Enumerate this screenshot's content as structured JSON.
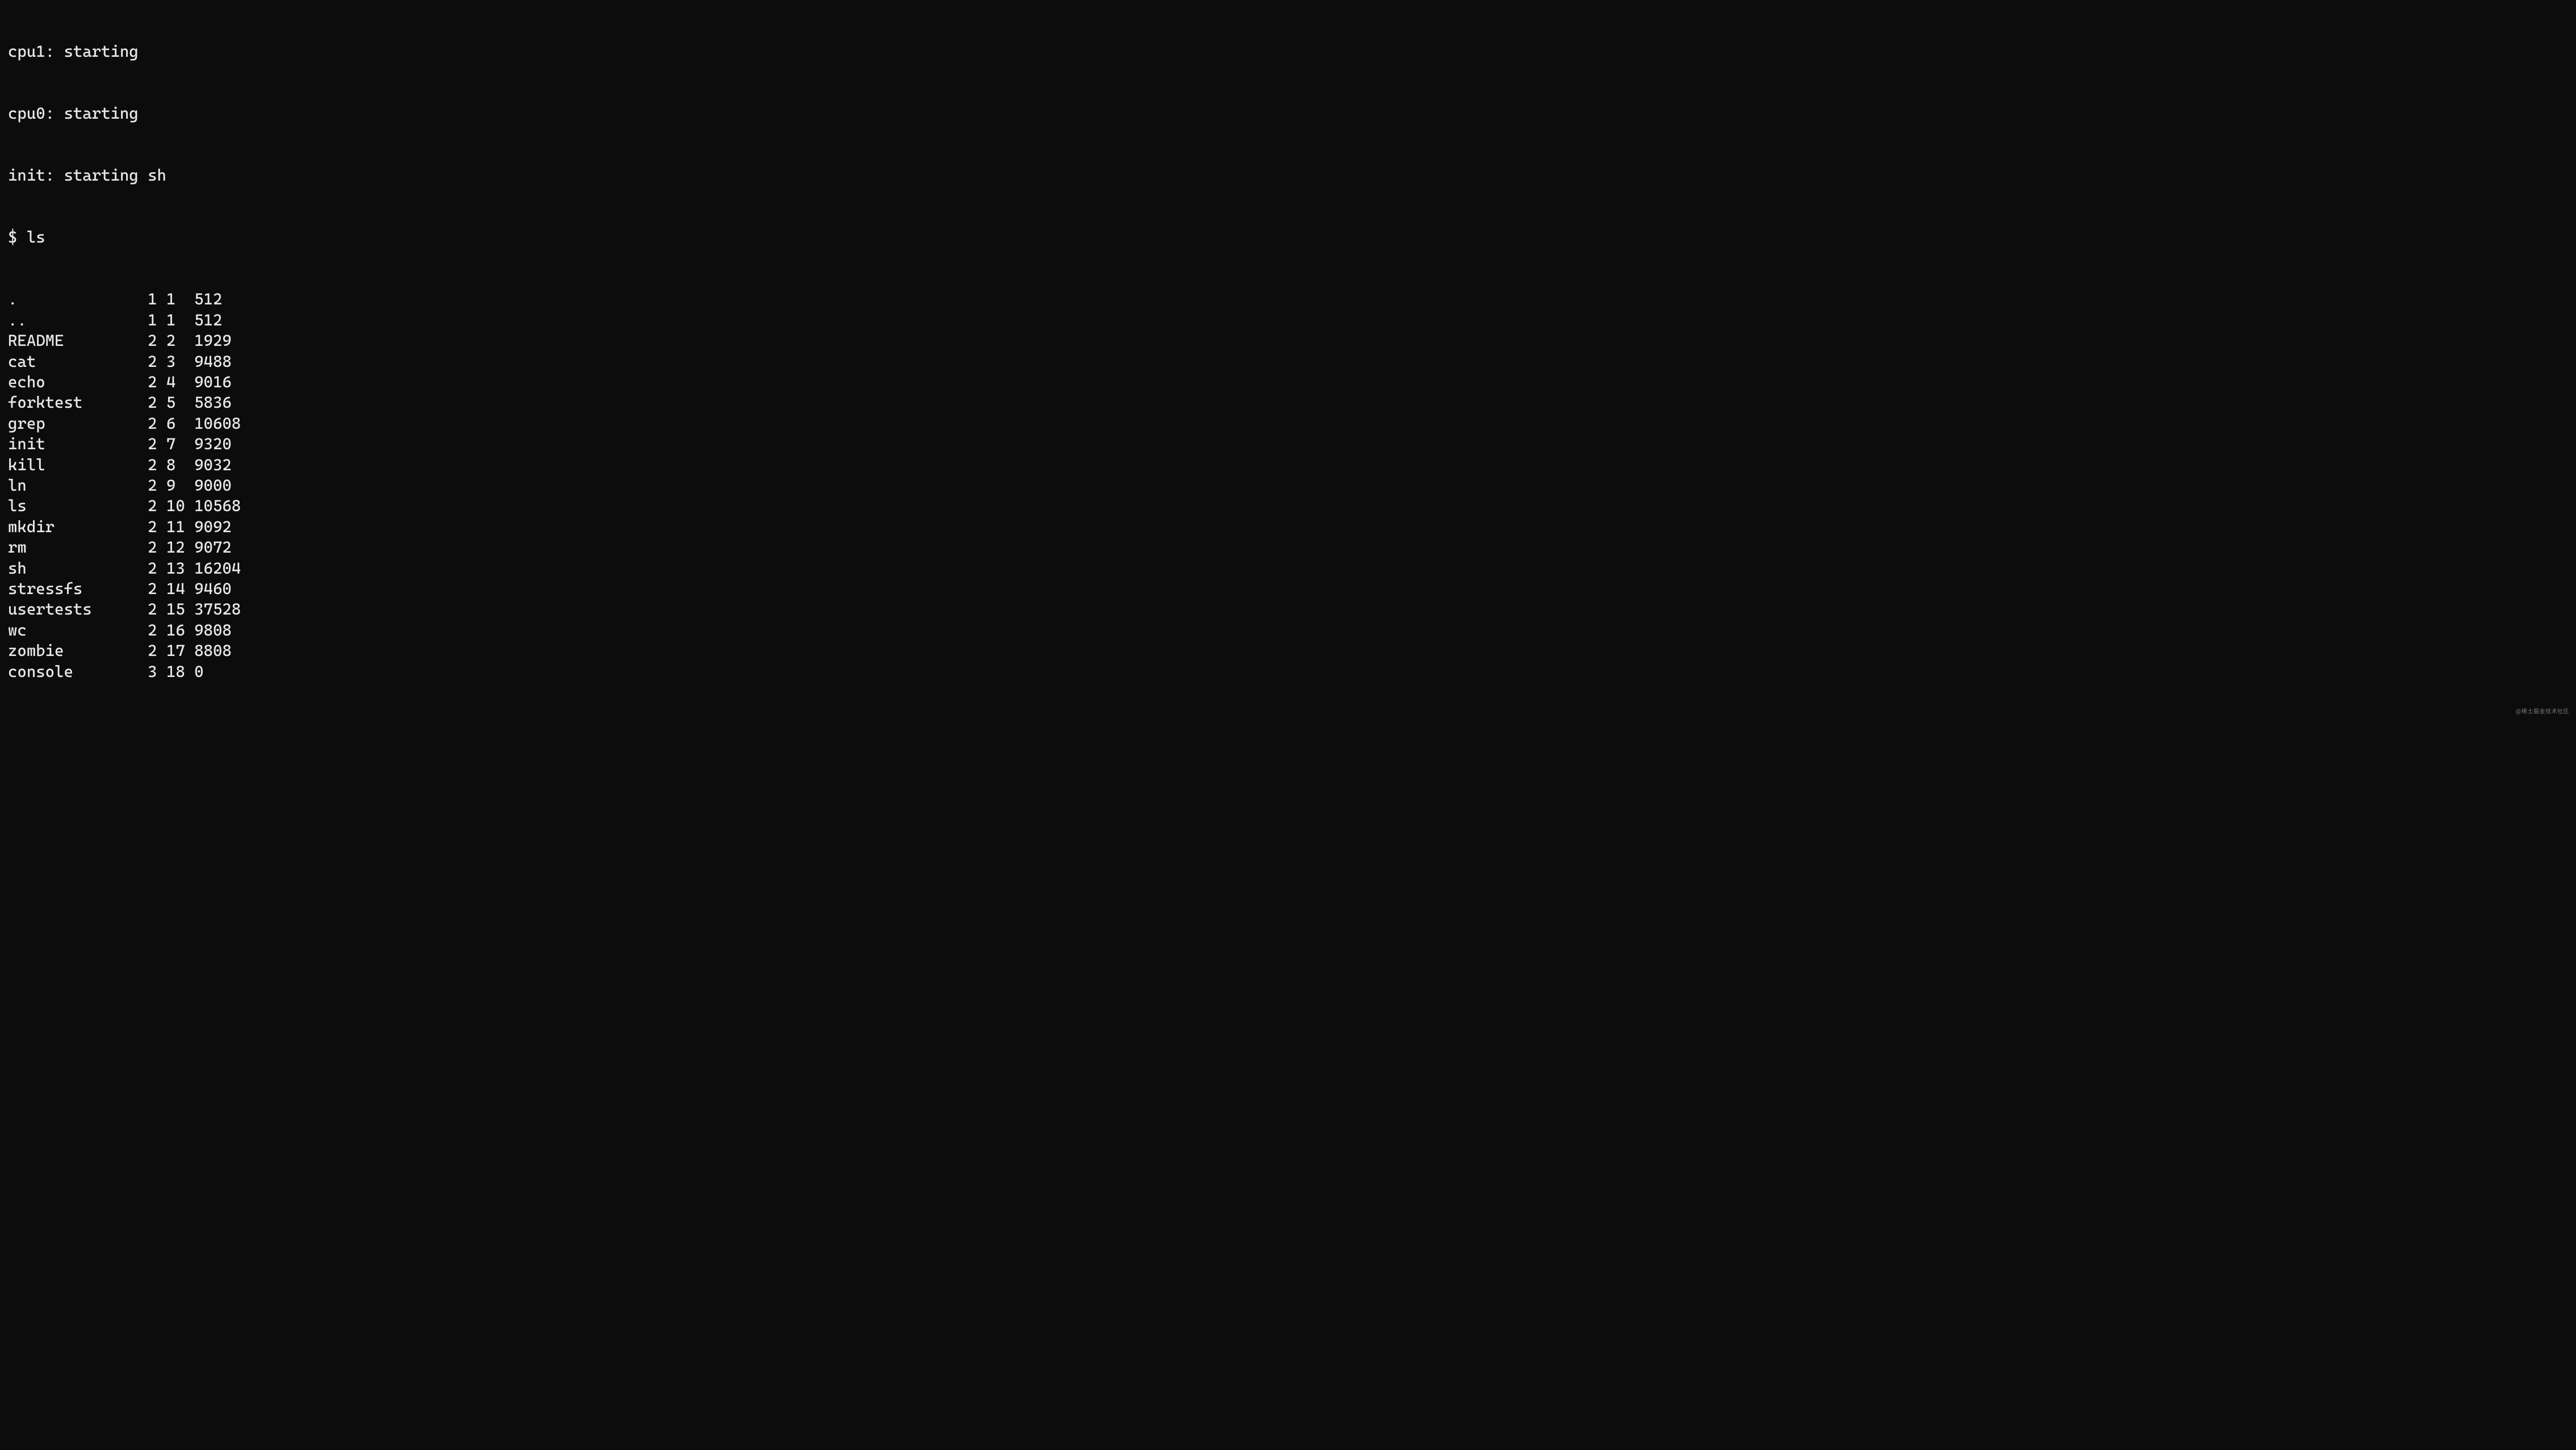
{
  "boot": [
    "cpu1: starting",
    "cpu0: starting",
    "init: starting sh"
  ],
  "prompt": "$ ",
  "command": "ls",
  "listing": [
    {
      "name": ".",
      "c1": "1",
      "c2": "1",
      "c3": "512"
    },
    {
      "name": "..",
      "c1": "1",
      "c2": "1",
      "c3": "512"
    },
    {
      "name": "README",
      "c1": "2",
      "c2": "2",
      "c3": "1929"
    },
    {
      "name": "cat",
      "c1": "2",
      "c2": "3",
      "c3": "9488"
    },
    {
      "name": "echo",
      "c1": "2",
      "c2": "4",
      "c3": "9016"
    },
    {
      "name": "forktest",
      "c1": "2",
      "c2": "5",
      "c3": "5836"
    },
    {
      "name": "grep",
      "c1": "2",
      "c2": "6",
      "c3": "10608"
    },
    {
      "name": "init",
      "c1": "2",
      "c2": "7",
      "c3": "9320"
    },
    {
      "name": "kill",
      "c1": "2",
      "c2": "8",
      "c3": "9032"
    },
    {
      "name": "ln",
      "c1": "2",
      "c2": "9",
      "c3": "9000"
    },
    {
      "name": "ls",
      "c1": "2",
      "c2": "10",
      "c3": "10568"
    },
    {
      "name": "mkdir",
      "c1": "2",
      "c2": "11",
      "c3": "9092"
    },
    {
      "name": "rm",
      "c1": "2",
      "c2": "12",
      "c3": "9072"
    },
    {
      "name": "sh",
      "c1": "2",
      "c2": "13",
      "c3": "16204"
    },
    {
      "name": "stressfs",
      "c1": "2",
      "c2": "14",
      "c3": "9460"
    },
    {
      "name": "usertests",
      "c1": "2",
      "c2": "15",
      "c3": "37528"
    },
    {
      "name": "wc",
      "c1": "2",
      "c2": "16",
      "c3": "9808"
    },
    {
      "name": "zombie",
      "c1": "2",
      "c2": "17",
      "c3": "8808"
    },
    {
      "name": "console",
      "c1": "3",
      "c2": "18",
      "c3": "0"
    }
  ],
  "watermark": "@稀土掘金技术社区"
}
